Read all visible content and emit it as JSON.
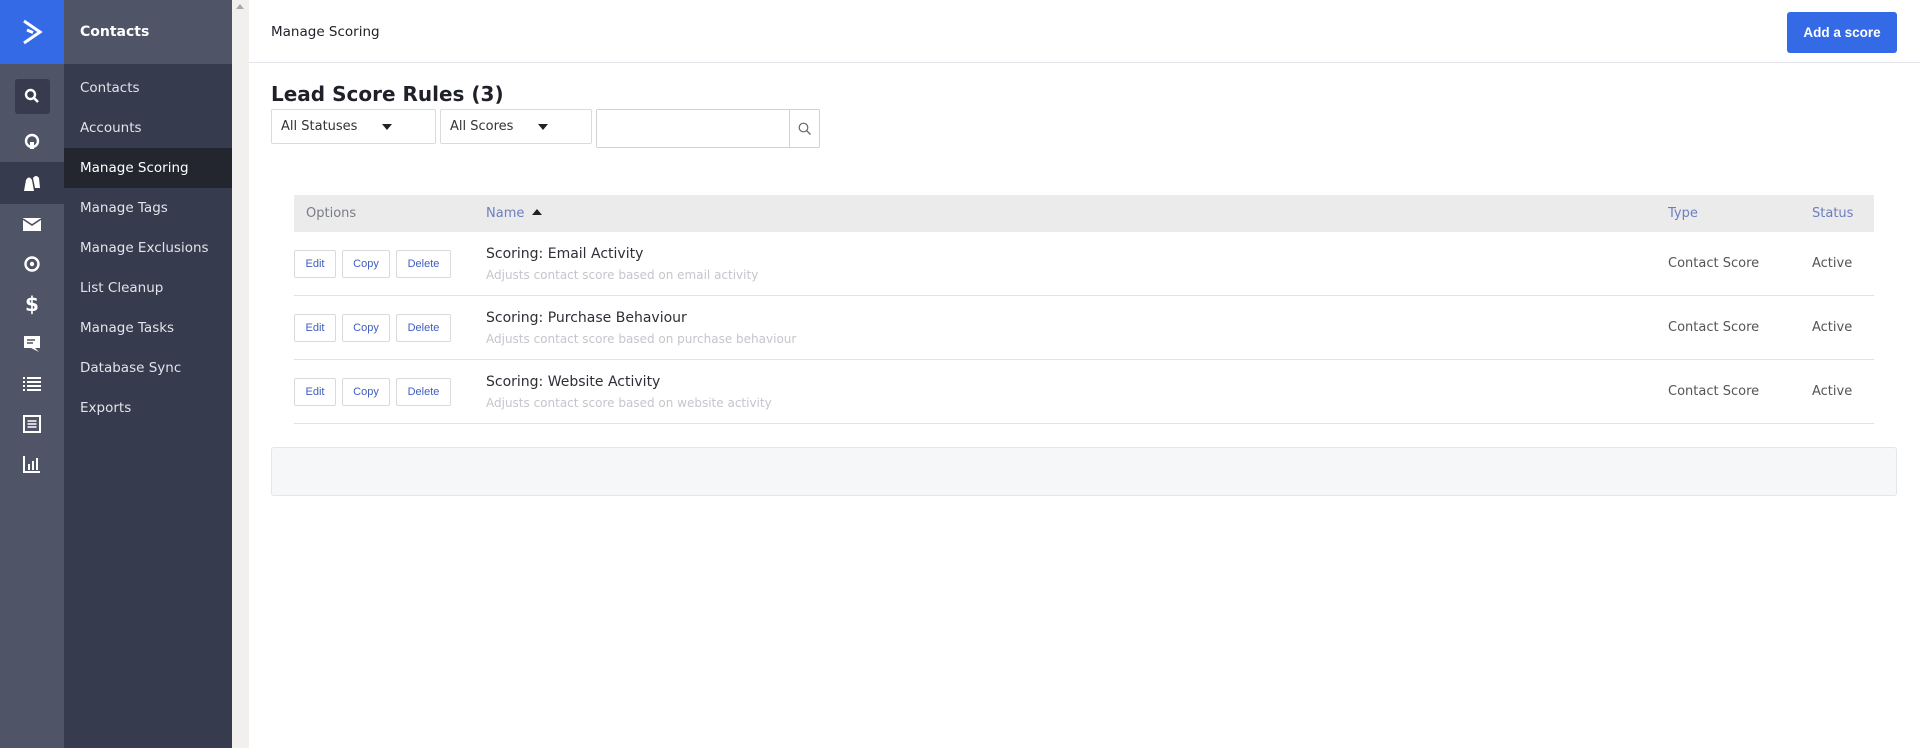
{
  "rail": {
    "logo": "activecampaign-logo-icon",
    "items": [
      {
        "icon": "search-icon",
        "active": false
      },
      {
        "icon": "location-pin-icon",
        "active": false
      },
      {
        "icon": "contacts-icon",
        "active": true
      },
      {
        "icon": "envelope-icon",
        "active": false
      },
      {
        "icon": "target-icon",
        "active": false
      },
      {
        "icon": "dollar-icon",
        "active": false
      },
      {
        "icon": "chat-icon",
        "active": false
      },
      {
        "icon": "list-icon",
        "active": false
      },
      {
        "icon": "document-icon",
        "active": false
      },
      {
        "icon": "bar-chart-icon",
        "active": false
      }
    ]
  },
  "nav": {
    "title": "Contacts",
    "items": [
      {
        "label": "Contacts",
        "active": false
      },
      {
        "label": "Accounts",
        "active": false
      },
      {
        "label": "Manage Scoring",
        "active": true
      },
      {
        "label": "Manage Tags",
        "active": false
      },
      {
        "label": "Manage Exclusions",
        "active": false
      },
      {
        "label": "List Cleanup",
        "active": false
      },
      {
        "label": "Manage Tasks",
        "active": false
      },
      {
        "label": "Database Sync",
        "active": false
      },
      {
        "label": "Exports",
        "active": false
      }
    ]
  },
  "header": {
    "title": "Manage Scoring",
    "add_button": "Add a score"
  },
  "page": {
    "heading": "Lead Score Rules (3)",
    "filters": {
      "status": "All Statuses",
      "scores": "All Scores",
      "search_value": "",
      "search_placeholder": ""
    }
  },
  "table": {
    "columns": {
      "options": "Options",
      "name": "Name",
      "type": "Type",
      "status": "Status"
    },
    "sort": {
      "column": "name",
      "direction": "ascending"
    },
    "actions": {
      "edit": "Edit",
      "copy": "Copy",
      "delete": "Delete"
    },
    "rows": [
      {
        "name": "Scoring: Email Activity",
        "description": "Adjusts contact score based on email activity",
        "type": "Contact Score",
        "status": "Active"
      },
      {
        "name": "Scoring: Purchase Behaviour",
        "description": "Adjusts contact score based on purchase behaviour",
        "type": "Contact Score",
        "status": "Active"
      },
      {
        "name": "Scoring: Website Activity",
        "description": "Adjusts contact score based on website activity",
        "type": "Contact Score",
        "status": "Active"
      }
    ]
  },
  "colors": {
    "brand_blue": "#356ae6",
    "rail_bg": "#4f5467",
    "nav_bg": "#363b4d",
    "nav_active_bg": "#23262f",
    "link_blue": "#3f5ec0"
  }
}
